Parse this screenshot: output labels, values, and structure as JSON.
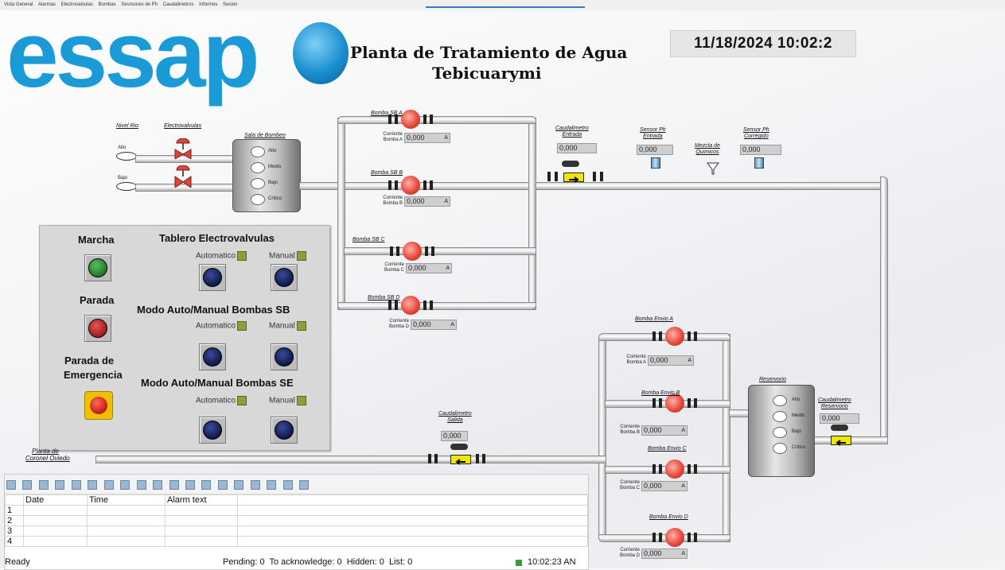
{
  "menu": [
    "Vista General",
    "Alarmas",
    "Electrovalvulas",
    "Bombas",
    "Sesnsores de Ph",
    "Caudalimetros",
    "Informes",
    "Sesion"
  ],
  "logo_text": "essap",
  "title_line1": "Planta de Tratamiento de Agua",
  "title_line2": "Tebicuarymi",
  "clock": "11/18/2024 10:02:2",
  "inlet": {
    "nivel_label": "Nivel Rio",
    "alto": "Alto",
    "bajo": "Bajo",
    "electrovalvulas_label": "Electrovalvulas",
    "sala_label": "Sala de Bombeo",
    "levels": [
      "Alto",
      "Medio",
      "Bajo",
      "Critico"
    ]
  },
  "pumps_sb": [
    {
      "label": "Bomba SB A",
      "corr1": "Corriente",
      "corr2": "Bomba A",
      "value": "0,000",
      "unit": "A"
    },
    {
      "label": "Bomba SB B",
      "corr1": "Corriente",
      "corr2": "Bomba B",
      "value": "0,000",
      "unit": "A"
    },
    {
      "label": "Bomba SB C",
      "corr1": "Corriente",
      "corr2": "Bomba C",
      "value": "0,000",
      "unit": "A"
    },
    {
      "label": "Bomba SB D",
      "corr1": "Corriente",
      "corr2": "Bomba D",
      "value": "0,000",
      "unit": "A"
    }
  ],
  "caud_entrada": {
    "label1": "Caudalimetro",
    "label2": "Entrada",
    "value": "0,000"
  },
  "ph_entrada": {
    "label1": "Sensor Ph",
    "label2": "Entrada",
    "value": "0,000"
  },
  "mezcla": {
    "label1": "Mezcla de",
    "label2": "Quimicos"
  },
  "ph_corregido": {
    "label1": "Sensor Ph",
    "label2": "Corregido",
    "value": "0,000"
  },
  "panel": {
    "marcha": "Marcha",
    "parada": "Parada",
    "emergencia1": "Parada de",
    "emergencia2": "Emergencia",
    "tablero": "Tablero Electrovalvulas",
    "modo_sb": "Modo Auto/Manual Bombas SB",
    "modo_se": "Modo Auto/Manual Bombas SE",
    "automatico": "Automatico",
    "manual": "Manual"
  },
  "pumps_se": [
    {
      "label": "Bomba Envio A",
      "corr1": "Corriente",
      "corr2": "Bomba A",
      "value": "0,000",
      "unit": "A"
    },
    {
      "label": "Bomba Envio B",
      "corr1": "Corriente",
      "corr2": "Bomba B",
      "value": "0,000",
      "unit": "A"
    },
    {
      "label": "Bomba Envio C",
      "corr1": "Corriente",
      "corr2": "Bomba C",
      "value": "0,000",
      "unit": "A"
    },
    {
      "label": "Bomba Envio D",
      "corr1": "Corriente",
      "corr2": "Bomba D",
      "value": "0,000",
      "unit": "A"
    }
  ],
  "reservorio": {
    "label": "Reservorio",
    "levels": [
      "Alto",
      "Medio",
      "Bajo",
      "Critico"
    ]
  },
  "caud_reservorio": {
    "label1": "Caudalimetro",
    "label2": "Reservorio",
    "value": "0,000"
  },
  "caud_salida": {
    "label1": "Caudalimetro",
    "label2": "Salida",
    "value": "0,000"
  },
  "destino": {
    "line1": "Planta de",
    "line2": "Coronel Oviedo"
  },
  "alarms": {
    "columns": [
      "Date",
      "Time",
      "Alarm text"
    ],
    "rows": [
      "1",
      "2",
      "3",
      "4"
    ]
  },
  "status": {
    "ready": "Ready",
    "counts": "Pending: 0  To acknowledge: 0  Hidden: 0  List: 0",
    "time": "10:02:23 AN"
  },
  "colors": {
    "brand": "#1a9ad6",
    "pump": "#e84a3c",
    "flow": "#f2e600",
    "marcha": "#1f7a2a",
    "parada": "#a51c1c",
    "mode_btn": "#0f1a4a"
  }
}
